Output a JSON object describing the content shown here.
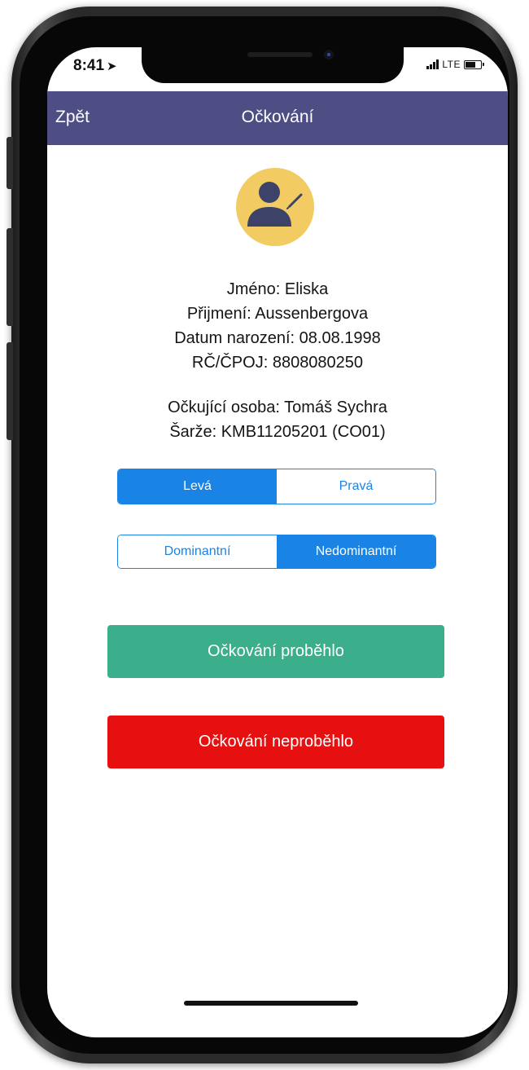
{
  "status_bar": {
    "time": "8:41",
    "network": "LTE",
    "icons": [
      "location-arrow-icon",
      "signal-icon",
      "battery-icon"
    ]
  },
  "nav": {
    "back_label": "Zpět",
    "title": "Očkování"
  },
  "avatar": {
    "icon": "user-edit-icon",
    "color": "#f2cc63",
    "figure_color": "#3d4368"
  },
  "patient": {
    "first_name": "Jméno: Eliska",
    "last_name": "Přijmení: Aussenbergova",
    "birth_date": "Datum narození: 08.08.1998",
    "id_number": "RČ/ČPOJ: 8808080250"
  },
  "vaccination": {
    "vaccinator": "Očkující osoba: Tomáš Sychra",
    "batch": "Šarže: KMB11205201 (CO01)"
  },
  "side_selector": {
    "options": [
      "Levá",
      "Pravá"
    ],
    "selected": "Levá"
  },
  "dominance_selector": {
    "options": [
      "Dominantní",
      "Nedominantní"
    ],
    "selected": "Nedominantní"
  },
  "actions": {
    "done_label": "Očkování proběhlo",
    "not_done_label": "Očkování neproběhlo"
  },
  "colors": {
    "navbar": "#4e4d84",
    "accent": "#1a84e6",
    "success": "#3bae8c",
    "danger": "#e61010"
  }
}
